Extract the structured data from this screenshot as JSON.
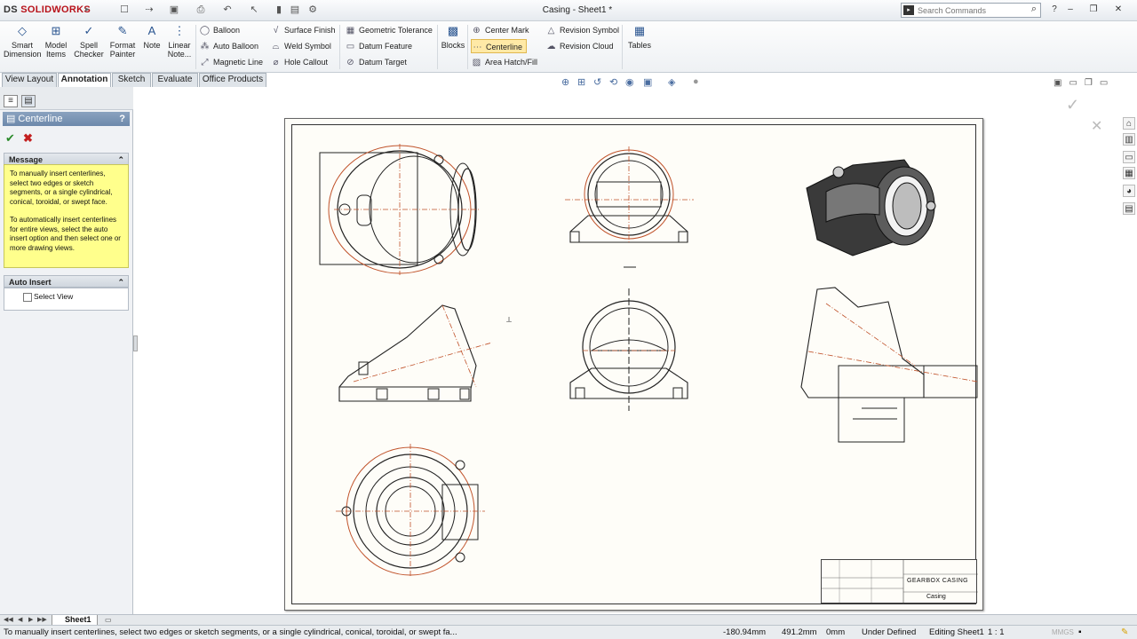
{
  "app": {
    "brand_prefix": "DS",
    "brand": "SOLIDWORKS",
    "document_title": "Casing - Sheet1 *"
  },
  "search": {
    "placeholder": "Search Commands"
  },
  "ribbon": {
    "smart_dimension": "Smart Dimension",
    "model_items": "Model Items",
    "spell_checker": "Spell Checker",
    "format_painter": "Format Painter",
    "note": "Note",
    "linear_note": "Linear Note...",
    "balloon": "Balloon",
    "auto_balloon": "Auto Balloon",
    "magnetic_line": "Magnetic Line",
    "surface_finish": "Surface Finish",
    "weld_symbol": "Weld Symbol",
    "hole_callout": "Hole Callout",
    "geometric_tolerance": "Geometric Tolerance",
    "datum_feature": "Datum Feature",
    "datum_target": "Datum Target",
    "blocks": "Blocks",
    "center_mark": "Center Mark",
    "centerline": "Centerline",
    "area_hatch": "Area Hatch/Fill",
    "revision_symbol": "Revision Symbol",
    "revision_cloud": "Revision Cloud",
    "tables": "Tables"
  },
  "tabs": [
    "View Layout",
    "Annotation",
    "Sketch",
    "Evaluate",
    "Office Products"
  ],
  "property_manager": {
    "title": "Centerline",
    "help": "?",
    "message_header": "Message",
    "message_p1": "To manually insert centerlines, select two edges or sketch segments, or a single cylindrical, conical, toroidal, or swept face.",
    "message_p2": "To automatically insert centerlines for entire views, select the auto insert option and then select one or more drawing views.",
    "auto_insert_header": "Auto Insert",
    "select_view_label": "Select View",
    "select_view_checked": false
  },
  "drawing": {
    "title_block_name": "GEARBOX CASING",
    "title_block_part": "Casing"
  },
  "sheet_tabs": {
    "active": "Sheet1"
  },
  "status": {
    "message": "To manually insert centerlines, select two edges or sketch segments, or a single cylindrical, conical, toroidal, or swept fa...",
    "x": "-180.94mm",
    "y": "491.2mm",
    "z": "0mm",
    "definition": "Under Defined",
    "mode": "Editing Sheet1",
    "scale": "1 : 1",
    "units": "MMGS"
  },
  "colors": {
    "accent": "#6d89ab",
    "message_bg": "#ffff8c",
    "centerline": "#c0522a"
  }
}
